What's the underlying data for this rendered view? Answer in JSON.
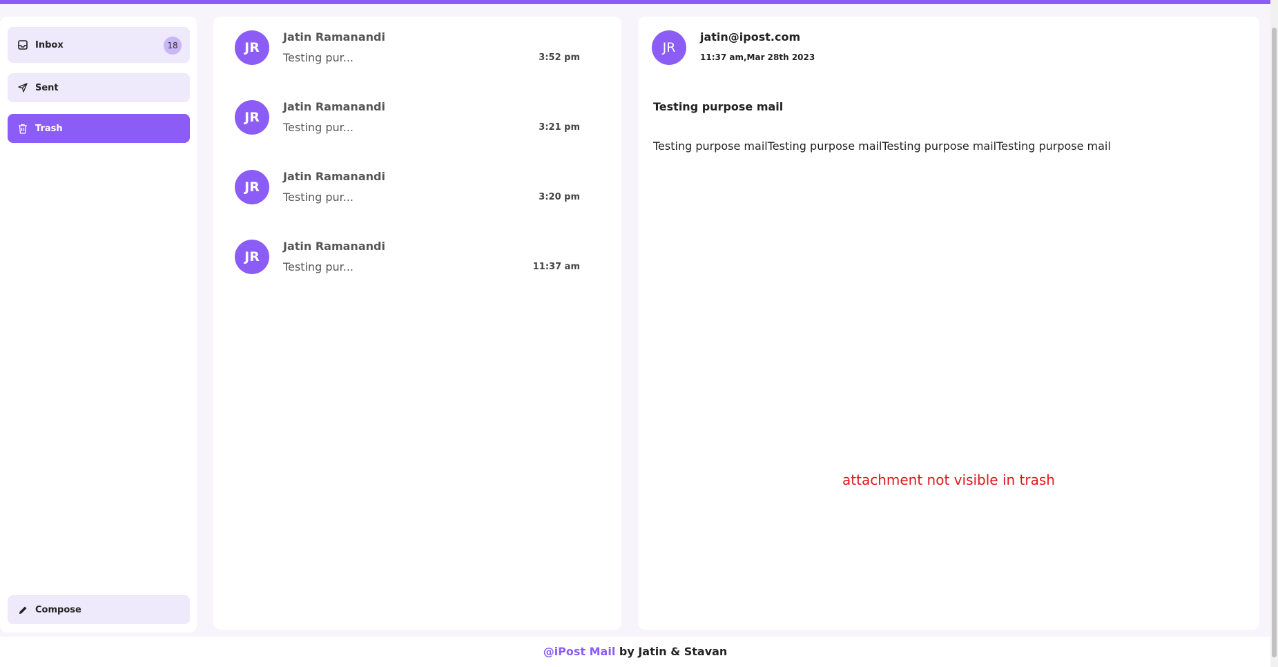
{
  "colors": {
    "accent": "#8b5cf6",
    "notice": "#e0151b"
  },
  "sidebar": {
    "items": [
      {
        "label": "Inbox",
        "icon": "inbox-icon",
        "badge": "18"
      },
      {
        "label": "Sent",
        "icon": "send-icon"
      },
      {
        "label": "Trash",
        "icon": "trash-icon"
      }
    ],
    "compose": {
      "label": "Compose",
      "icon": "pencil-icon"
    }
  },
  "mails": [
    {
      "initials": "JR",
      "name": "Jatin Ramanandi",
      "snippet": "Testing pur...",
      "time": "3:52 pm"
    },
    {
      "initials": "JR",
      "name": "Jatin Ramanandi",
      "snippet": "Testing pur...",
      "time": "3:21 pm"
    },
    {
      "initials": "JR",
      "name": "Jatin Ramanandi",
      "snippet": "Testing pur...",
      "time": "3:20 pm"
    },
    {
      "initials": "JR",
      "name": "Jatin Ramanandi",
      "snippet": "Testing pur...",
      "time": "11:37 am"
    }
  ],
  "detail": {
    "initials": "JR",
    "from": "jatin@ipost.com",
    "date": "11:37 am,Mar 28th 2023",
    "subject": "Testing purpose mail",
    "body": "Testing purpose mailTesting purpose mailTesting purpose mailTesting purpose mail",
    "notice": "attachment not visible in trash"
  },
  "footer": {
    "brand": "@iPost Mail",
    "credit": " by Jatin & Stavan"
  }
}
